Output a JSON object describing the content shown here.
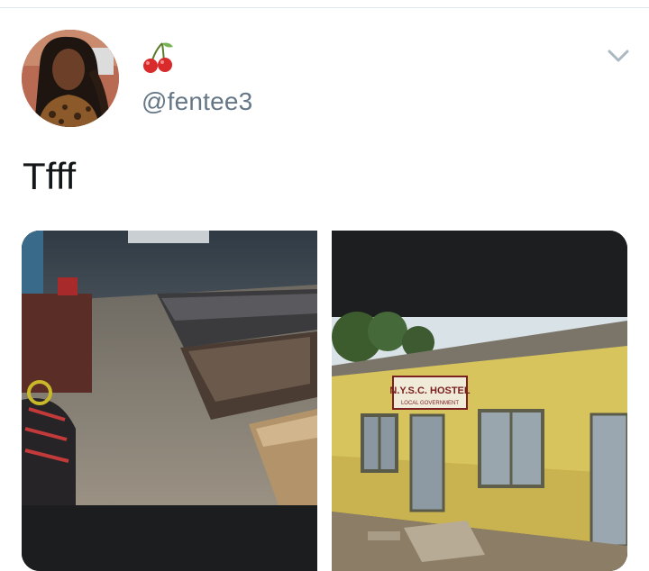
{
  "tweet": {
    "display_name_icon": "cherry-emoji",
    "handle": "@fentee3",
    "text": "Tfff",
    "menu_icon": "chevron-down-icon"
  },
  "media": {
    "left_image": "room-interior-with-mattresses",
    "right_image": "hostel-building-exterior",
    "hostel_sign_line1": "N.Y.S.C. HOSTEL",
    "hostel_sign_line2": "LOCAL GOVERNMENT"
  },
  "colors": {
    "handle": "#657786",
    "text": "#14171a",
    "divider": "#e1e8ed"
  }
}
